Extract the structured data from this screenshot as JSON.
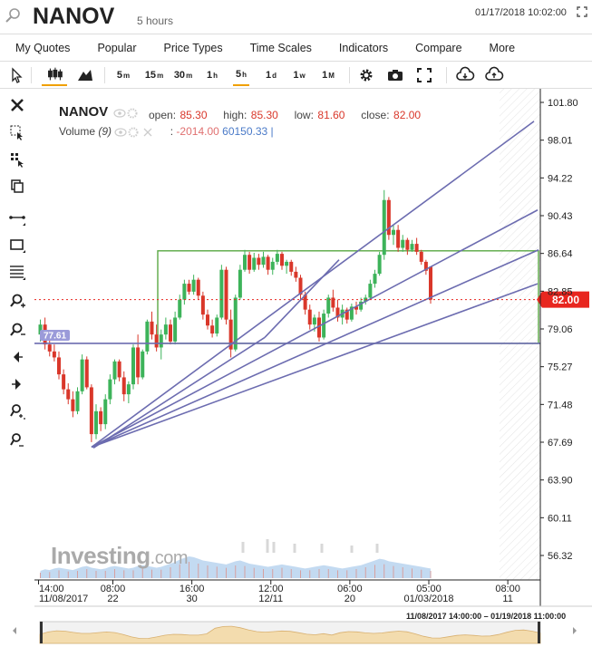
{
  "header": {
    "symbol": "NANOV",
    "timeframe": "5 hours",
    "datetime": "01/17/2018 10:02:00"
  },
  "menu": [
    "My Quotes",
    "Popular",
    "Price Types",
    "Time Scales",
    "Indicators",
    "Compare",
    "More"
  ],
  "toolbar": {
    "intervals": [
      {
        "num": "5",
        "unit": "m"
      },
      {
        "num": "15",
        "unit": "m"
      },
      {
        "num": "30",
        "unit": "m"
      },
      {
        "num": "1",
        "unit": "h"
      },
      {
        "num": "5",
        "unit": "h"
      },
      {
        "num": "1",
        "unit": "d"
      },
      {
        "num": "1",
        "unit": "w"
      },
      {
        "num": "1",
        "unit": "M"
      }
    ],
    "active_interval": 4
  },
  "legend": {
    "symbol": "NANOV",
    "open_label": "open:",
    "open": "85.30",
    "high_label": "high:",
    "high": "85.30",
    "low_label": "low:",
    "low": "81.60",
    "close_label": "close:",
    "close": "82.00",
    "volume_label": "Volume",
    "volume_param": "(9)",
    "volume_sep": ":",
    "volume_value1": "-2014.00",
    "volume_value2": "60150.33",
    "volume_cursor": "|"
  },
  "watermark": {
    "main": "Investing",
    "suffix": ".com"
  },
  "range_label": "11/08/2017 14:00:00 – 01/19/2018 11:00:00",
  "colors": {
    "up": "#3db35a",
    "down": "#d9372a",
    "trendline": "#6c6cb0",
    "rectangle": "#5aa845",
    "price_tag": "#e8261f",
    "hline_tag": "#9b9bd9",
    "volume_area": "#b9d3ef"
  },
  "chart_data": {
    "type": "candlestick",
    "title": "NANOV",
    "interval": "5 hours",
    "y_axis": {
      "ticks": [
        "101.80",
        "98.01",
        "94.22",
        "90.43",
        "86.64",
        "82.85",
        "79.06",
        "75.27",
        "71.48",
        "67.69",
        "63.90",
        "60.11",
        "56.32"
      ],
      "range": [
        54.5,
        103.0
      ]
    },
    "x_axis": {
      "ticks": [
        {
          "time": "14:00",
          "date": "11/08/2017"
        },
        {
          "time": "08:00",
          "date": "22"
        },
        {
          "time": "16:00",
          "date": "30"
        },
        {
          "time": "12:00",
          "date": "12/11"
        },
        {
          "time": "06:00",
          "date": "20"
        },
        {
          "time": "05:00",
          "date": "01/03/2018"
        },
        {
          "time": "08:00",
          "date": "11"
        }
      ],
      "tick_positions": [
        0,
        16,
        33,
        50,
        67,
        84,
        101
      ],
      "bar_count": 108
    },
    "candles": [
      [
        78.5,
        80.0,
        77.8,
        79.5
      ],
      [
        79.5,
        80.2,
        77.0,
        77.5
      ],
      [
        77.5,
        78.2,
        76.3,
        76.8
      ],
      [
        76.8,
        77.5,
        75.8,
        76.2
      ],
      [
        76.2,
        76.8,
        74.0,
        74.5
      ],
      [
        74.5,
        75.0,
        72.5,
        73.0
      ],
      [
        73.0,
        73.6,
        71.5,
        72.0
      ],
      [
        72.0,
        72.8,
        70.2,
        70.8
      ],
      [
        70.8,
        73.2,
        70.5,
        72.8
      ],
      [
        72.8,
        76.5,
        72.5,
        76.0
      ],
      [
        76.0,
        76.3,
        73.0,
        73.2
      ],
      [
        73.2,
        73.5,
        67.7,
        68.5
      ],
      [
        68.5,
        71.5,
        68.0,
        70.8
      ],
      [
        70.8,
        71.2,
        68.8,
        69.5
      ],
      [
        69.5,
        72.5,
        69.0,
        72.0
      ],
      [
        72.0,
        74.5,
        71.5,
        74.0
      ],
      [
        74.0,
        76.0,
        73.5,
        75.8
      ],
      [
        75.8,
        76.0,
        73.8,
        74.2
      ],
      [
        74.2,
        74.8,
        71.8,
        72.5
      ],
      [
        72.5,
        73.8,
        71.6,
        73.5
      ],
      [
        73.5,
        77.5,
        73.0,
        77.2
      ],
      [
        77.2,
        78.5,
        73.5,
        74.2
      ],
      [
        74.2,
        77.0,
        74.0,
        76.8
      ],
      [
        76.8,
        80.0,
        76.5,
        79.8
      ],
      [
        79.8,
        80.8,
        78.0,
        78.5
      ],
      [
        78.5,
        79.5,
        76.8,
        77.2
      ],
      [
        77.2,
        79.0,
        76.0,
        78.5
      ],
      [
        78.5,
        80.2,
        78.0,
        79.5
      ],
      [
        79.5,
        80.0,
        77.5,
        77.8
      ],
      [
        77.8,
        80.8,
        77.5,
        80.2
      ],
      [
        80.2,
        82.5,
        80.0,
        82.0
      ],
      [
        82.0,
        84.0,
        81.5,
        83.6
      ],
      [
        83.6,
        84.0,
        82.5,
        82.8
      ],
      [
        82.8,
        84.5,
        82.5,
        84.0
      ],
      [
        84.0,
        84.2,
        82.0,
        82.4
      ],
      [
        82.4,
        82.8,
        80.0,
        80.5
      ],
      [
        80.5,
        81.0,
        79.0,
        79.4
      ],
      [
        79.4,
        80.0,
        78.2,
        78.6
      ],
      [
        78.6,
        80.5,
        78.3,
        80.2
      ],
      [
        80.2,
        85.5,
        80.0,
        85.0
      ],
      [
        85.0,
        85.3,
        79.5,
        80.0
      ],
      [
        80.0,
        81.0,
        76.2,
        77.0
      ],
      [
        77.0,
        82.5,
        76.8,
        82.2
      ],
      [
        82.2,
        85.5,
        82.0,
        85.0
      ],
      [
        85.0,
        87.0,
        84.8,
        86.5
      ],
      [
        86.5,
        86.8,
        84.6,
        85.0
      ],
      [
        85.0,
        86.7,
        84.8,
        86.2
      ],
      [
        86.2,
        86.6,
        85.0,
        85.5
      ],
      [
        85.5,
        86.8,
        85.2,
        86.3
      ],
      [
        86.3,
        86.5,
        84.5,
        85.0
      ],
      [
        85.0,
        86.2,
        84.5,
        85.8
      ],
      [
        85.8,
        87.0,
        85.5,
        86.6
      ],
      [
        86.6,
        86.8,
        85.0,
        85.4
      ],
      [
        85.4,
        86.0,
        84.6,
        85.8
      ],
      [
        85.8,
        86.0,
        84.4,
        84.8
      ],
      [
        84.8,
        85.3,
        83.8,
        84.2
      ],
      [
        84.2,
        84.5,
        82.0,
        82.5
      ],
      [
        82.5,
        82.8,
        80.5,
        81.0
      ],
      [
        81.0,
        81.5,
        79.0,
        79.5
      ],
      [
        79.5,
        80.5,
        78.8,
        80.2
      ],
      [
        80.2,
        80.8,
        77.8,
        78.2
      ],
      [
        78.2,
        81.0,
        78.0,
        80.6
      ],
      [
        80.6,
        82.5,
        80.2,
        82.2
      ],
      [
        82.2,
        83.0,
        80.8,
        81.2
      ],
      [
        81.2,
        82.0,
        79.8,
        80.2
      ],
      [
        80.2,
        81.5,
        79.5,
        81.0
      ],
      [
        81.0,
        81.2,
        79.6,
        80.0
      ],
      [
        80.0,
        81.6,
        79.8,
        81.3
      ],
      [
        81.3,
        81.8,
        80.5,
        81.0
      ],
      [
        81.0,
        82.2,
        80.8,
        81.8
      ],
      [
        81.8,
        82.5,
        81.5,
        82.2
      ],
      [
        82.2,
        84.0,
        82.0,
        83.6
      ],
      [
        83.6,
        85.0,
        83.2,
        84.6
      ],
      [
        84.6,
        86.8,
        84.4,
        86.5
      ],
      [
        86.5,
        93.0,
        86.0,
        92.0
      ],
      [
        92.0,
        92.3,
        88.0,
        88.5
      ],
      [
        88.5,
        89.5,
        87.5,
        89.0
      ],
      [
        89.0,
        89.5,
        86.8,
        87.2
      ],
      [
        87.2,
        88.5,
        86.8,
        88.0
      ],
      [
        88.0,
        88.2,
        86.5,
        87.0
      ],
      [
        87.0,
        88.0,
        86.8,
        87.6
      ],
      [
        87.6,
        88.2,
        86.5,
        86.8
      ],
      [
        86.8,
        87.0,
        85.5,
        85.8
      ],
      [
        85.8,
        86.0,
        84.5,
        84.9
      ],
      [
        85.3,
        85.3,
        81.6,
        82.0
      ]
    ],
    "volume": [
      9,
      11,
      10,
      12,
      13,
      12,
      11,
      10,
      12,
      14,
      15,
      13,
      12,
      11,
      12,
      14,
      15,
      14,
      13,
      12,
      13,
      15,
      16,
      15,
      14,
      13,
      14,
      16,
      18,
      20,
      23,
      25,
      27,
      26,
      24,
      22,
      21,
      20,
      19,
      18,
      17,
      19,
      21,
      22,
      20,
      18,
      17,
      16,
      15,
      14,
      15,
      16,
      17,
      16,
      15,
      14,
      13,
      12,
      13,
      14,
      15,
      16,
      15,
      14,
      13,
      12,
      13,
      14,
      15,
      16,
      18,
      20,
      22,
      24,
      23,
      21,
      20,
      19,
      18,
      17,
      16,
      15,
      14,
      13,
      12
    ],
    "current_price": "82.00",
    "horizontal_line": "77.61",
    "annotations": [
      "trend lines",
      "rectangle"
    ]
  }
}
